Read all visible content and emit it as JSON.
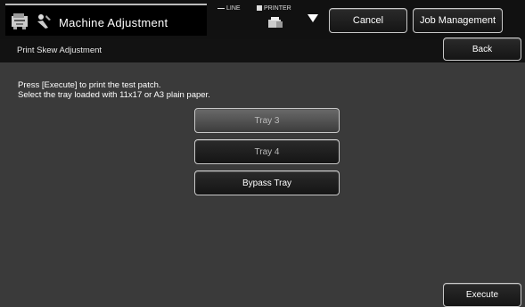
{
  "topbar": {
    "title": "Machine Adjustment",
    "line_label": "LINE",
    "printer_label": "PRINTER",
    "cancel_label": "Cancel",
    "job_management_label": "Job Management"
  },
  "header": {
    "title": "Print Skew Adjustment",
    "back_label": "Back"
  },
  "main": {
    "instruction_line1": "Press [Execute] to print the test patch.",
    "instruction_line2": "Select the tray loaded with 11x17 or A3 plain paper.",
    "trays": [
      {
        "label": "Tray 3",
        "selected": true
      },
      {
        "label": "Tray 4",
        "selected": false
      },
      {
        "label": "Bypass Tray",
        "selected": false
      }
    ],
    "execute_label": "Execute"
  },
  "icons": [
    "machine-icon",
    "adjustment-tool-icon",
    "printer-icon",
    "dropdown-triangle-icon"
  ],
  "colors": {
    "background": "#3a3a3a",
    "bar": "#111111",
    "button_border": "#c8c8c8",
    "selected": "#6a6a6a"
  }
}
